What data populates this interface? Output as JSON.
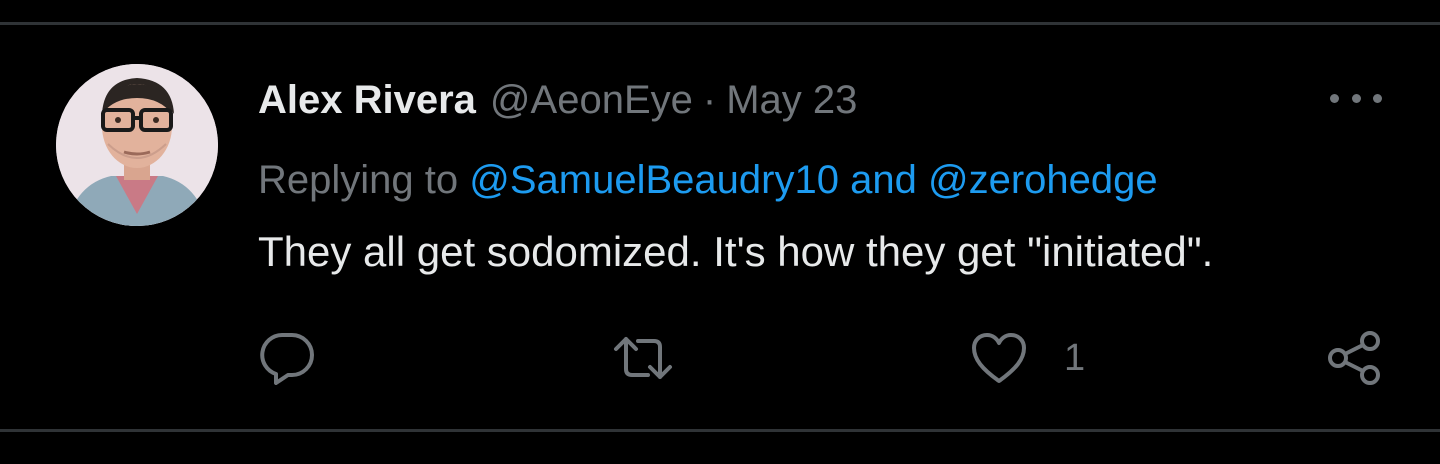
{
  "tweet": {
    "author_name": "Alex Rivera",
    "handle": "@AeonEye",
    "separator": "·",
    "date": "May 23",
    "reply_prefix": "Replying to",
    "reply_mention_1": "@SamuelBeaudry10",
    "reply_and": "and",
    "reply_mention_2": "@zerohedge",
    "text": "They all get sodomized. It's how they get \"initiated\".",
    "like_count": "1"
  },
  "icons": {
    "reply": "reply-icon",
    "retweet": "retweet-icon",
    "like": "heart-icon",
    "share": "share-icon",
    "more": "more-icon"
  },
  "colors": {
    "background": "#000000",
    "primary_text": "#e7e9ea",
    "secondary_text": "#71767b",
    "mention": "#1d9bf0",
    "divider": "#2f3336"
  }
}
